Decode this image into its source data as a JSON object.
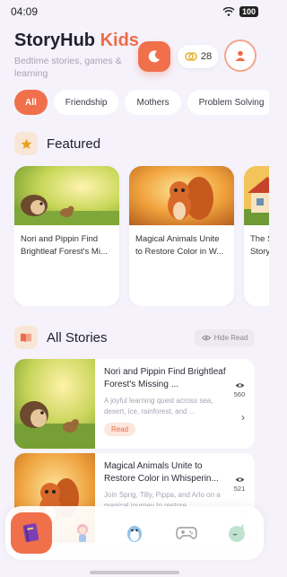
{
  "status_bar": {
    "time": "04:09",
    "battery": "100"
  },
  "header": {
    "brand": "StoryHub",
    "brand_accent": "Kids",
    "tagline": "Bedtime stories, games & learning",
    "coins": "28"
  },
  "categories": [
    "All",
    "Friendship",
    "Mothers",
    "Problem Solving"
  ],
  "featured": {
    "title": "Featured",
    "items": [
      {
        "title": "Nori and Pippin Find Brightleaf Forest's Mi..."
      },
      {
        "title": "Magical Animals Unite to Restore Color in W..."
      },
      {
        "title": "The S Story"
      }
    ]
  },
  "all_stories": {
    "title": "All Stories",
    "hide_read_label": "Hide Read",
    "items": [
      {
        "title": "Nori and Pippin Find Brightleaf Forest's Missing ...",
        "description": "A joyful learning quest across sea, desert, ice, rainforest, and ...",
        "badge": "Read",
        "views": "560"
      },
      {
        "title": "Magical Animals Unite to Restore Color in Whisperin...",
        "description": "Join Sprig, Tilly, Pippa, and Arlo on a magical journey to restore ...",
        "views": "521"
      }
    ]
  },
  "bottom_nav": {
    "items": [
      {
        "icon": "book-icon",
        "active": true
      },
      {
        "icon": "girl-character-icon"
      },
      {
        "icon": "penguin-icon"
      },
      {
        "icon": "gamepad-icon"
      },
      {
        "icon": "sleepy-moon-icon"
      }
    ]
  },
  "colors": {
    "accent": "#f0704c",
    "background": "#f5f2fb"
  }
}
